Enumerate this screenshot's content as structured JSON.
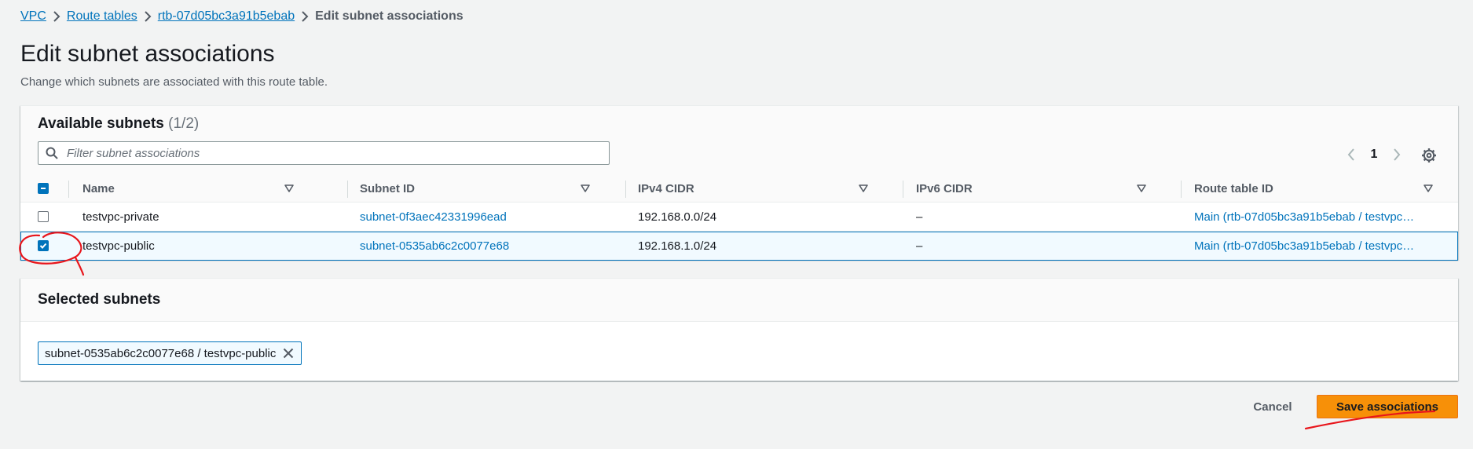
{
  "breadcrumb": {
    "items": [
      "VPC",
      "Route tables",
      "rtb-07d05bc3a91b5ebab"
    ],
    "current": "Edit subnet associations"
  },
  "page": {
    "title": "Edit subnet associations",
    "description": "Change which subnets are associated with this route table."
  },
  "available": {
    "title": "Available subnets",
    "count": "(1/2)",
    "filter_placeholder": "Filter subnet associations",
    "filter_value": "",
    "page_number": "1",
    "columns": [
      "Name",
      "Subnet ID",
      "IPv4 CIDR",
      "IPv6 CIDR",
      "Route table ID"
    ],
    "rows": [
      {
        "name": "testvpc-private",
        "subnet_id": "subnet-0f3aec42331996ead",
        "ipv4": "192.168.0.0/24",
        "ipv6": "–",
        "route_table": "Main (rtb-07d05bc3a91b5ebab / testvpc…",
        "checked": false
      },
      {
        "name": "testvpc-public",
        "subnet_id": "subnet-0535ab6c2c0077e68",
        "ipv4": "192.168.1.0/24",
        "ipv6": "–",
        "route_table": "Main (rtb-07d05bc3a91b5ebab / testvpc…",
        "checked": true
      }
    ]
  },
  "selected": {
    "title": "Selected subnets",
    "tokens": [
      "subnet-0535ab6c2c0077e68 / testvpc-public"
    ]
  },
  "actions": {
    "cancel": "Cancel",
    "save": "Save associations"
  },
  "colors": {
    "link": "#0073bb",
    "primary": "#f79008",
    "annotation": "#e8151b"
  },
  "icons": [
    "chevron-right-icon",
    "search-icon",
    "chevron-left-icon",
    "gear-icon",
    "sort-down-icon",
    "check-icon",
    "minus-icon",
    "close-icon"
  ]
}
